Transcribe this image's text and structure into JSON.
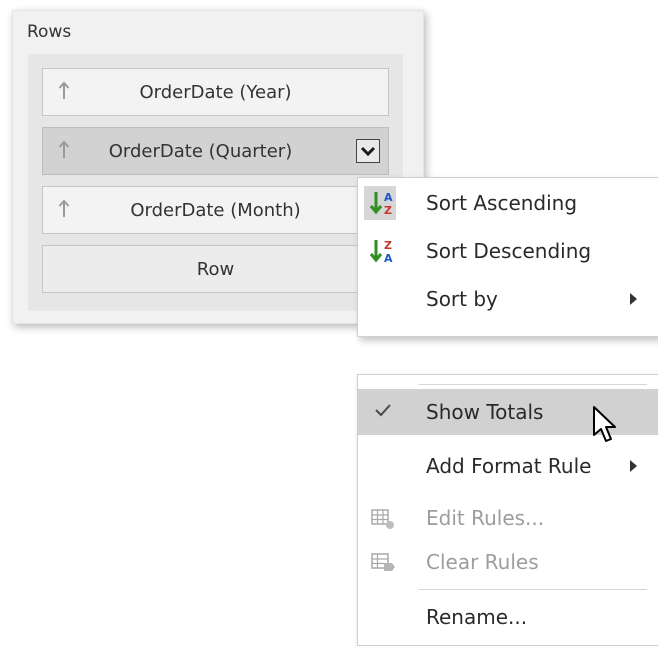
{
  "rows_panel": {
    "title": "Rows",
    "fields": [
      {
        "label": "OrderDate (Year)",
        "active": false
      },
      {
        "label": "OrderDate (Quarter)",
        "active": true
      },
      {
        "label": "OrderDate (Month)",
        "active": false
      }
    ],
    "drop_placeholder": "Row"
  },
  "sort_menu": {
    "items": [
      {
        "label": "Sort Ascending",
        "icon": "sort-ascending-icon",
        "highlighted": true
      },
      {
        "label": "Sort Descending",
        "icon": "sort-descending-icon"
      },
      {
        "label": "Sort by",
        "has_submenu": true
      }
    ]
  },
  "context_menu": {
    "items": [
      {
        "label": "Show Totals",
        "icon": "checkmark-icon",
        "checked": true,
        "highlighted": true
      },
      {
        "label": "Add Format Rule",
        "has_submenu": true
      },
      {
        "label": "Edit Rules...",
        "icon": "edit-rules-icon",
        "disabled": true
      },
      {
        "label": "Clear Rules",
        "icon": "clear-rules-icon",
        "disabled": true
      },
      {
        "label": "Rename..."
      }
    ]
  },
  "colors": {
    "highlight": "#d1d1d1",
    "sort_icon_green": "#2f8f1f",
    "sort_icon_blue": "#1e56c9",
    "sort_icon_red": "#c8352a"
  }
}
